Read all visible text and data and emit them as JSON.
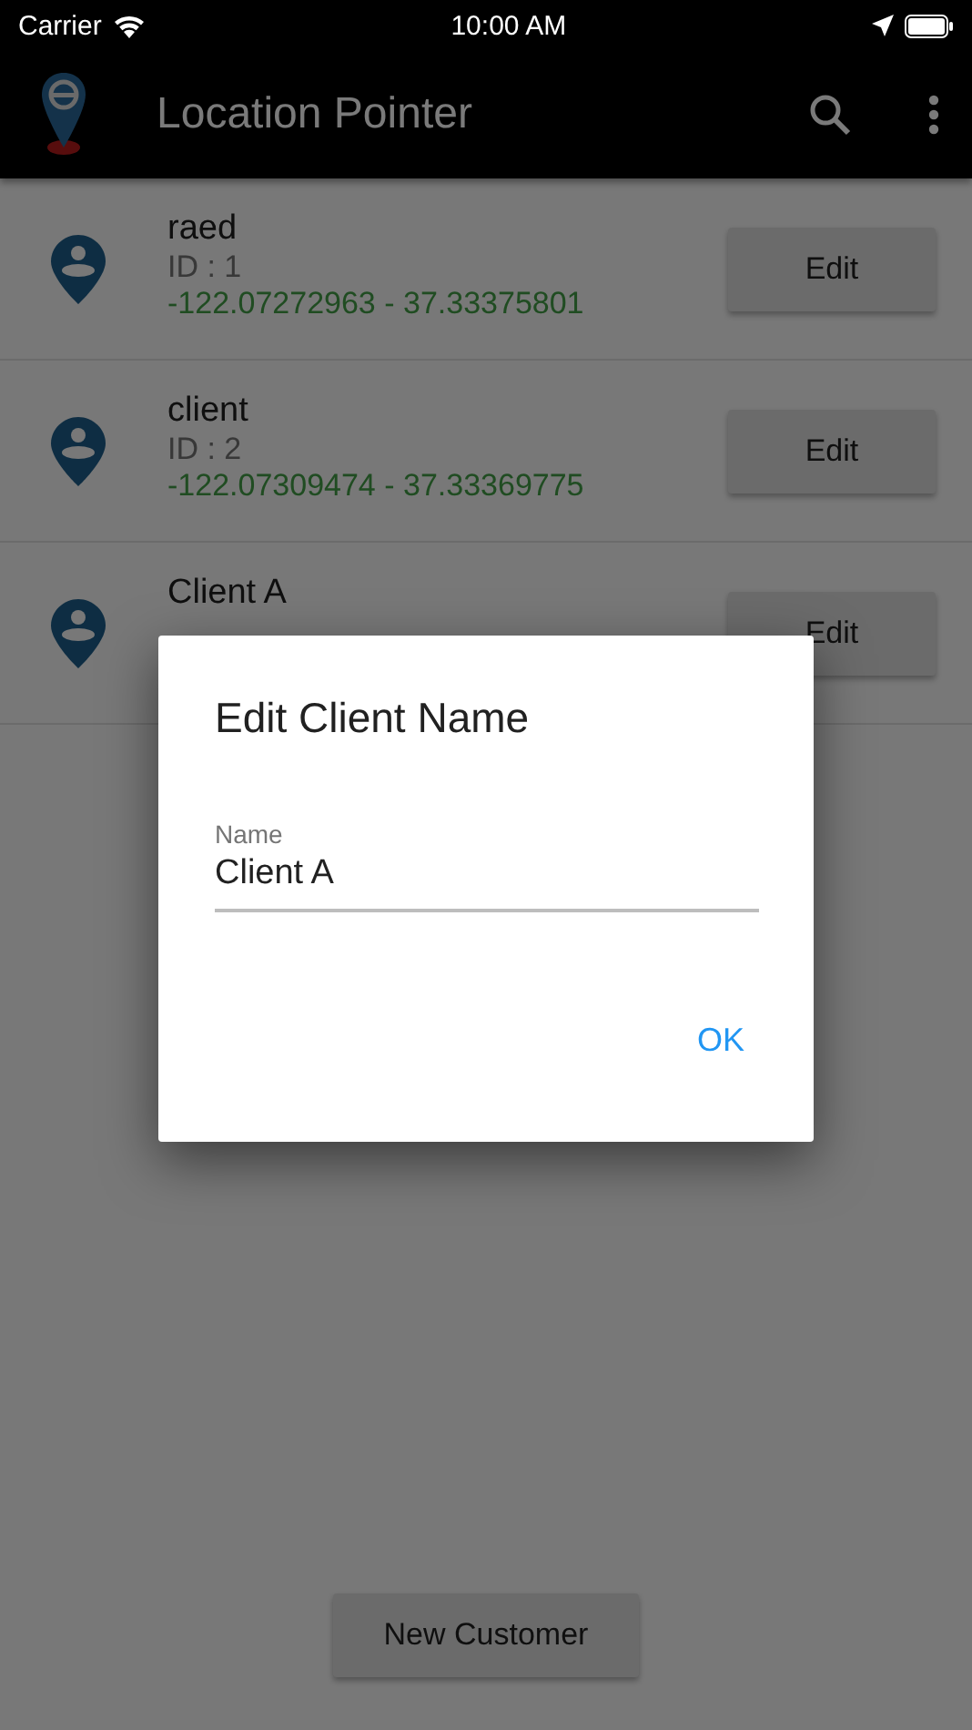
{
  "status_bar": {
    "carrier": "Carrier",
    "time": "10:00 AM"
  },
  "app_bar": {
    "title": "Location Pointer"
  },
  "customers": [
    {
      "name": "raed",
      "id": "ID : 1",
      "coords": "-122.07272963 - 37.33375801",
      "action": "Edit"
    },
    {
      "name": "client",
      "id": "ID : 2",
      "coords": "-122.07309474 - 37.33369775",
      "action": "Edit"
    },
    {
      "name": "Client A",
      "action": "Edit"
    }
  ],
  "new_customer_button": "New Customer",
  "dialog": {
    "title": "Edit Client Name",
    "field": {
      "label": "Name",
      "value": "Client A"
    },
    "ok": "OK"
  }
}
